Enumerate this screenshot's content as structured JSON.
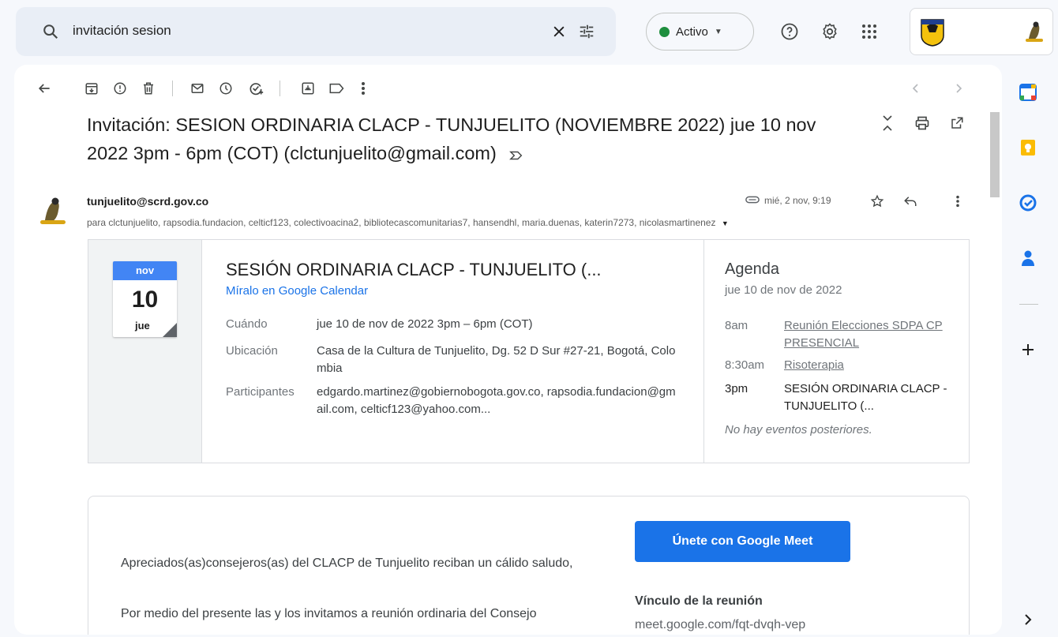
{
  "search": {
    "value": "invitación sesion"
  },
  "status": {
    "label": "Activo"
  },
  "email": {
    "subject": "Invitación: SESION ORDINARIA CLACP - TUNJUELITO (NOVIEMBRE 2022) jue 10 nov 2022 3pm - 6pm (COT) (clctunjuelito@gmail.com)",
    "sender": "tunjuelito@scrd.gov.co",
    "recipients": "para clctunjuelito, rapsodia.fundacion, celticf123, colectivoacina2, bibliotecascomunitarias7, hansendhl, maria.duenas, katerin7273, nicolasmartinenez",
    "date": "mié, 2 nov, 9:19"
  },
  "invite": {
    "month": "nov",
    "day": "10",
    "weekday": "jue",
    "title": "SESIÓN ORDINARIA CLACP - TUNJUELITO (...",
    "calendar_link": "Míralo en Google Calendar",
    "when_label": "Cuándo",
    "when_value": "jue 10 de nov de 2022 3pm – 6pm (COT)",
    "where_label": "Ubicación",
    "where_value": "Casa de la Cultura de Tunjuelito, Dg. 52 D Sur #27-21, Bogotá, Colombia",
    "who_label": "Participantes",
    "who_value": "edgardo.martinez@gobiernobogota.gov.co, rapsodia.fundacion@gmail.com, celticf123@yahoo.com..."
  },
  "agenda": {
    "title": "Agenda",
    "date": "jue 10 de nov de 2022",
    "events": [
      {
        "time": "8am",
        "label": "Reunión Elecciones SDPA CP PRESENCIAL"
      },
      {
        "time": "8:30am",
        "label": "Risoterapia"
      },
      {
        "time": "3pm",
        "label": "SESIÓN ORDINARIA CLACP - TUNJUELITO (..."
      }
    ],
    "none": "No hay eventos posteriores."
  },
  "body": {
    "greeting": "Apreciados(as)consejeros(as) del CLACP de Tunjuelito reciban un cálido saludo,",
    "p2": "Por medio del presente las y los invitamos a reunión ordinaria del Consejo"
  },
  "meet": {
    "button": "Únete con Google Meet",
    "link_label": "Vínculo de la reunión",
    "url": "meet.google.com/fqt-dvqh-vep"
  },
  "colors": {
    "accent": "#1a73e8",
    "active": "#1e8e3e",
    "background": "#f6f8fc"
  }
}
